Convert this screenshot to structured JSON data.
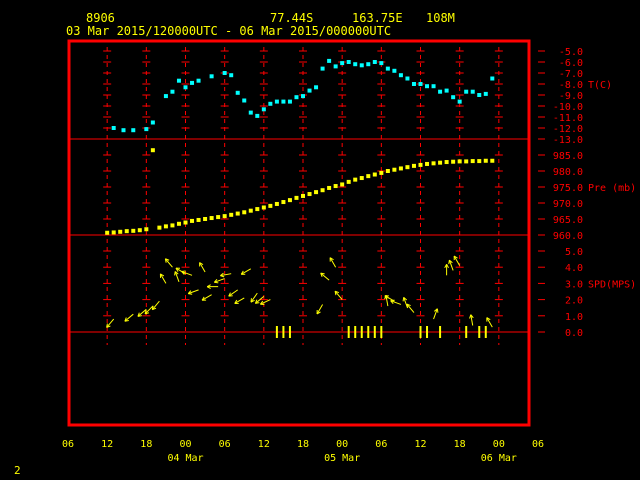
{
  "header": {
    "station_id": "8906",
    "lat": "77.44S",
    "lon": "163.75E",
    "elev": "108M",
    "range": "03 Mar 2015/120000UTC - 06 Mar 2015/000000UTC"
  },
  "page_number": "2",
  "colors": {
    "frame": "#ff0000",
    "grid": "#ff0000",
    "temperature": "#00ffff",
    "pressure": "#ffff00",
    "wind": "#ffff00",
    "axis_text": "#ffff00",
    "right_text": "#ff0000",
    "background": "#000000"
  },
  "chart_data": [
    {
      "panel": "temperature",
      "type": "scatter",
      "ylabel": "T(C)",
      "ylim": [
        -13,
        -5
      ],
      "yticks": [
        "-5.0",
        "-6.0",
        "-7.0",
        "-8.0",
        "-9.0",
        "-10.0",
        "-11.0",
        "-12.0",
        "-13.0"
      ],
      "x_hours": [
        13,
        14.5,
        16,
        18,
        19,
        21,
        22,
        23,
        24,
        25,
        26,
        28,
        30,
        31,
        32,
        33,
        34,
        35,
        36,
        37,
        38,
        39,
        40,
        41,
        42,
        43,
        44,
        45,
        46,
        47,
        48,
        49,
        50,
        51,
        52,
        53,
        54,
        55,
        56,
        57,
        58,
        59,
        60,
        61,
        62,
        63,
        64,
        65,
        66,
        67,
        68,
        69,
        70,
        71
      ],
      "values": [
        -12.0,
        -12.2,
        -12.2,
        -12.1,
        -11.5,
        -9.1,
        -8.7,
        -7.7,
        -8.3,
        -7.9,
        -7.7,
        -7.3,
        -7.0,
        -7.2,
        -8.8,
        -9.5,
        -10.6,
        -10.9,
        -10.3,
        -9.8,
        -9.6,
        -9.6,
        -9.6,
        -9.2,
        -9.1,
        -8.6,
        -8.3,
        -6.6,
        -5.9,
        -6.4,
        -6.1,
        -6.0,
        -6.2,
        -6.3,
        -6.2,
        -6.0,
        -6.1,
        -6.6,
        -6.8,
        -7.2,
        -7.5,
        -8.0,
        -8.0,
        -8.2,
        -8.2,
        -8.7,
        -8.6,
        -9.2,
        -9.6,
        -8.7,
        -8.7,
        -9.0,
        -8.9,
        -7.5
      ]
    },
    {
      "panel": "pressure",
      "type": "scatter",
      "ylabel": "Pre (mb)",
      "ylim": [
        960,
        985
      ],
      "yticks": [
        "985.0",
        "980.0",
        "975.0",
        "970.0",
        "965.0",
        "960.0"
      ],
      "x_hours": [
        12,
        13,
        14,
        15,
        16,
        17,
        18,
        19,
        20,
        21,
        22,
        23,
        24,
        25,
        26,
        27,
        28,
        29,
        30,
        31,
        32,
        33,
        34,
        35,
        36,
        37,
        38,
        39,
        40,
        41,
        42,
        43,
        44,
        45,
        46,
        47,
        48,
        49,
        50,
        51,
        52,
        53,
        54,
        55,
        56,
        57,
        58,
        59,
        60,
        61,
        62,
        63,
        64,
        65,
        66,
        67,
        68,
        69,
        70,
        71
      ],
      "values": [
        960.7,
        960.8,
        961.0,
        961.2,
        961.3,
        961.5,
        961.8,
        986.5,
        962.3,
        962.7,
        963.0,
        963.5,
        963.9,
        964.4,
        964.7,
        965.0,
        965.3,
        965.6,
        965.9,
        966.3,
        966.7,
        967.1,
        967.6,
        968.1,
        968.6,
        969.1,
        969.7,
        970.3,
        970.9,
        971.6,
        972.2,
        972.8,
        973.4,
        974.0,
        974.7,
        975.3,
        975.8,
        976.6,
        977.3,
        977.8,
        978.4,
        978.9,
        979.4,
        980.0,
        980.4,
        980.8,
        981.2,
        981.6,
        981.9,
        982.2,
        982.4,
        982.6,
        982.8,
        982.9,
        983.0,
        983.0,
        983.1,
        983.1,
        983.2,
        983.2
      ]
    },
    {
      "panel": "wind",
      "type": "scatter",
      "ylabel": "SPD(MPS)",
      "ylim": [
        0,
        5
      ],
      "yticks": [
        "5.0",
        "4.0",
        "3.0",
        "2.0",
        "1.0",
        "0.0"
      ],
      "x_hours": [
        13,
        16,
        18,
        19,
        20,
        21,
        22,
        23,
        24,
        25,
        26,
        27,
        28,
        29,
        30,
        31,
        32,
        33,
        34,
        35,
        36,
        37,
        38,
        39,
        40,
        45,
        46,
        47,
        48,
        49,
        50,
        51,
        52,
        53,
        54,
        55,
        56,
        57,
        58,
        59,
        60,
        61,
        62,
        63,
        64,
        65,
        66,
        67,
        68,
        69,
        70,
        71
      ],
      "speeds": [
        0.8,
        1.1,
        1.4,
        1.6,
        1.9,
        3.0,
        4.0,
        3.1,
        3.6,
        3.5,
        2.6,
        3.7,
        2.3,
        2.8,
        3.3,
        3.6,
        2.6,
        2.1,
        3.9,
        2.4,
        2.2,
        2.0,
        0,
        0,
        0,
        1.7,
        3.2,
        4.0,
        2.0,
        0,
        0,
        0,
        0,
        0,
        0,
        1.6,
        1.9,
        1.7,
        1.5,
        1.2,
        0,
        0,
        0.8,
        0,
        3.5,
        3.8,
        4.1,
        0,
        0.4,
        0,
        0,
        0.3
      ],
      "directions_deg": [
        220,
        230,
        230,
        225,
        220,
        330,
        320,
        340,
        300,
        290,
        250,
        330,
        240,
        270,
        250,
        260,
        235,
        240,
        240,
        215,
        230,
        245,
        0,
        0,
        0,
        210,
        310,
        330,
        320,
        0,
        0,
        0,
        0,
        0,
        0,
        350,
        300,
        290,
        340,
        320,
        0,
        0,
        20,
        0,
        0,
        340,
        330,
        0,
        350,
        0,
        0,
        330
      ]
    }
  ],
  "x_axis": {
    "start_hour": 6,
    "end_hour": 78,
    "tick_labels": [
      "06",
      "12",
      "18",
      "00",
      "06",
      "12",
      "18",
      "00",
      "06",
      "12",
      "18",
      "00",
      "06"
    ],
    "day_labels": [
      "04 Mar",
      "05 Mar",
      "06 Mar"
    ]
  }
}
